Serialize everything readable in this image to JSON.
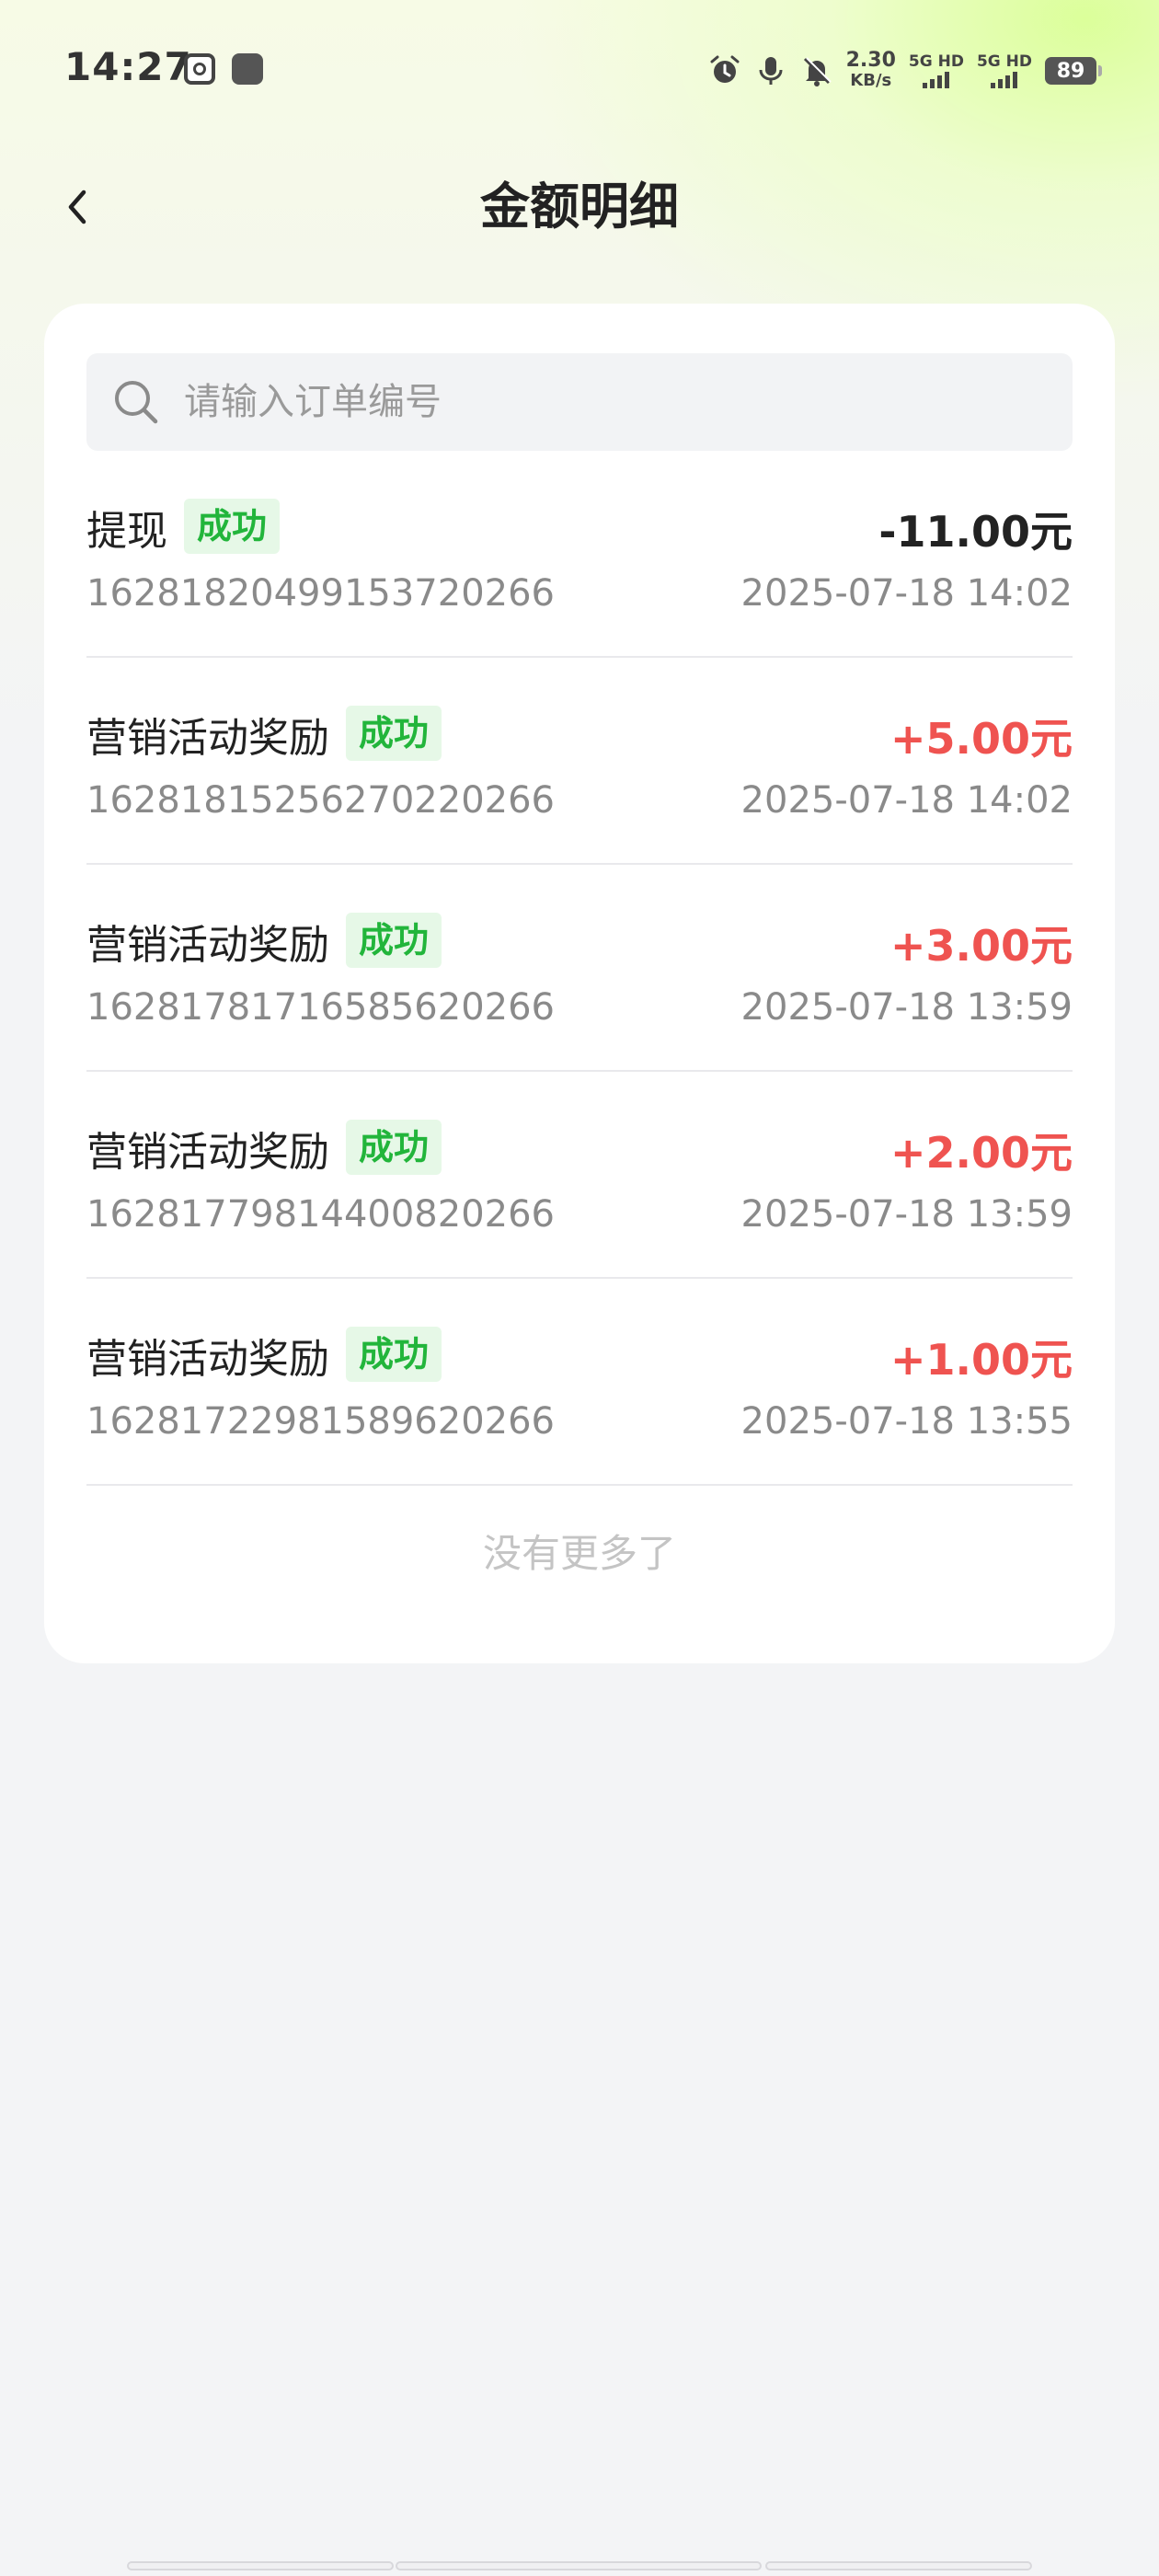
{
  "status_bar": {
    "time": "14:27",
    "net_speed_value": "2.30",
    "net_speed_unit": "KB/s",
    "sim1_label": "5G HD",
    "sim2_label": "5G HD",
    "battery": "89"
  },
  "nav": {
    "title": "金额明细",
    "back_icon": "chevron-left-icon"
  },
  "search": {
    "placeholder": "请输入订单编号",
    "value": ""
  },
  "records": [
    {
      "title": "提现",
      "status": "成功",
      "order_id": "1628182049915372026​6",
      "amount": "-11.00元",
      "time": "2025-07-18 14:02",
      "direction": "out"
    },
    {
      "title": "营销活动奖励",
      "status": "成功",
      "order_id": "1628181525627022026​6",
      "amount": "+5.00元",
      "time": "2025-07-18 14:02",
      "direction": "in"
    },
    {
      "title": "营销活动奖励",
      "status": "成功",
      "order_id": "1628178171658562026​6",
      "amount": "+3.00元",
      "time": "2025-07-18 13:59",
      "direction": "in"
    },
    {
      "title": "营销活动奖励",
      "status": "成功",
      "order_id": "1628177981440082026​6",
      "amount": "+2.00元",
      "time": "2025-07-18 13:59",
      "direction": "in"
    },
    {
      "title": "营销活动奖励",
      "status": "成功",
      "order_id": "1628172298158962026​6",
      "amount": "+1.00元",
      "time": "2025-07-18 13:55",
      "direction": "in"
    }
  ],
  "footer": {
    "no_more": "没有更多了"
  },
  "colors": {
    "success_badge_text": "#22b53b",
    "success_badge_bg": "#e6f8e7",
    "income": "#ef5350",
    "expense": "#222222"
  }
}
